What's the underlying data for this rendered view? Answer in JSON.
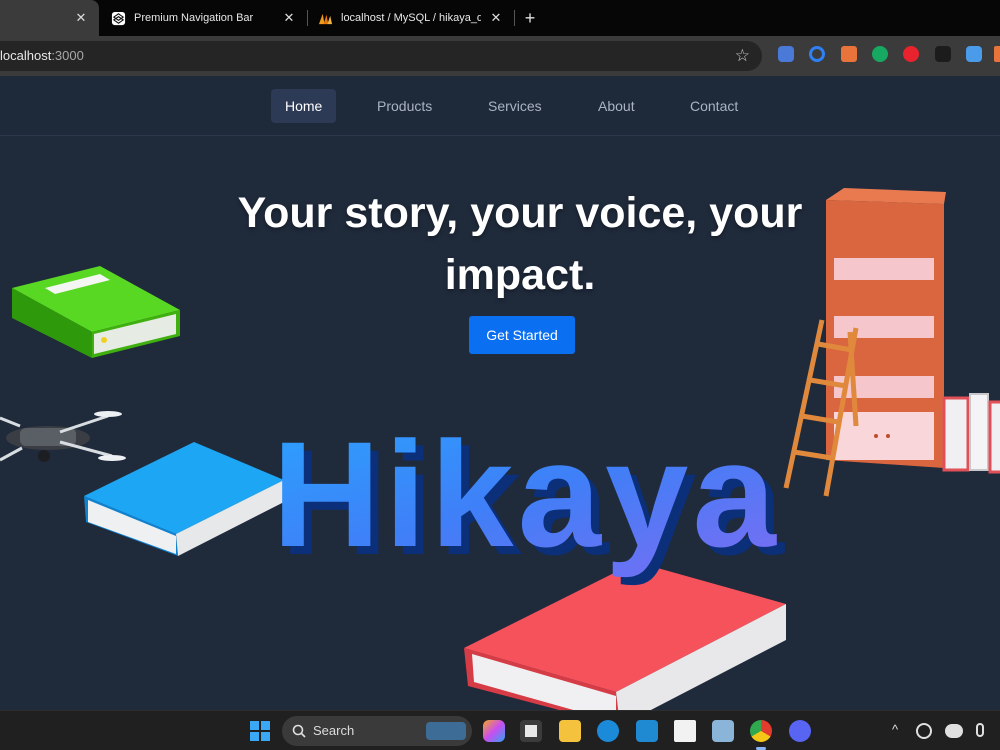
{
  "browser": {
    "tabs": [
      {
        "title": ""
      },
      {
        "title": "Premium Navigation Bar"
      },
      {
        "title": "localhost / MySQL / hikaya_db /"
      }
    ],
    "new_tab": "+",
    "close_glyph": "✕",
    "url_host": "localhost",
    "url_port": ":3000",
    "bookmark_glyph": "☆"
  },
  "nav": {
    "links": [
      "Home",
      "Products",
      "Services",
      "About",
      "Contact"
    ],
    "active": "Home"
  },
  "hero": {
    "line1": "Your story, your voice, your",
    "line2": "impact.",
    "cta": "Get Started",
    "logo_text": "Hikaya"
  },
  "taskbar": {
    "search_label": "Search"
  },
  "colors": {
    "page_bg": "#1f2a3b",
    "accent": "#0a6ff0",
    "logo_blue": "#2f8cf5",
    "book_green": "#4ccd1e",
    "book_blue": "#1a9cf0",
    "book_red": "#f0545c",
    "shelf": "#d9663f"
  }
}
